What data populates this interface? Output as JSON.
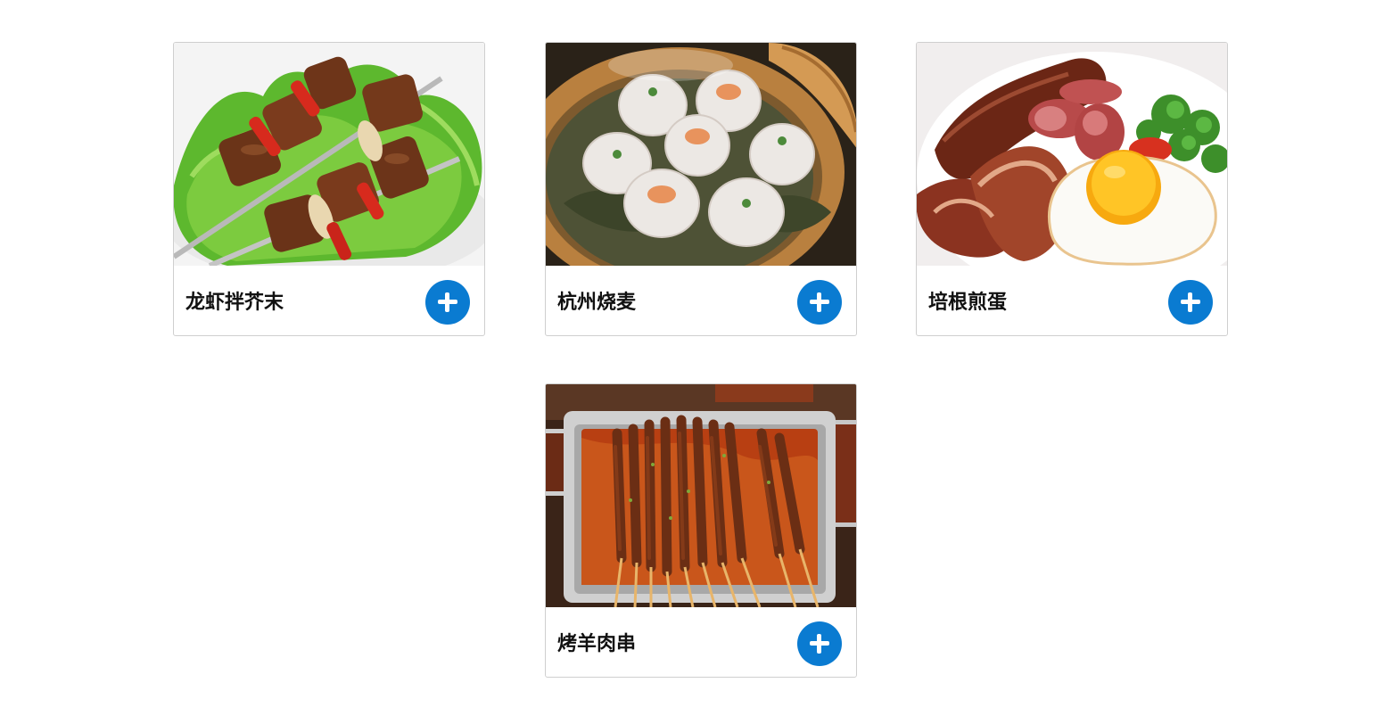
{
  "menu": {
    "items": [
      {
        "name": "龙虾拌芥末",
        "image_icon": "grilled-meat-skewers-photo",
        "add_label": "+"
      },
      {
        "name": "杭州烧麦",
        "image_icon": "steamed-shumai-photo",
        "add_label": "+"
      },
      {
        "name": "培根煎蛋",
        "image_icon": "bacon-fried-egg-photo",
        "add_label": "+"
      },
      {
        "name": "烤羊肉串",
        "image_icon": "lamb-skewers-photo",
        "add_label": "+"
      }
    ]
  },
  "colors": {
    "accent": "#0a7bd1",
    "card_border": "#cfcfcf",
    "text": "#111111"
  }
}
